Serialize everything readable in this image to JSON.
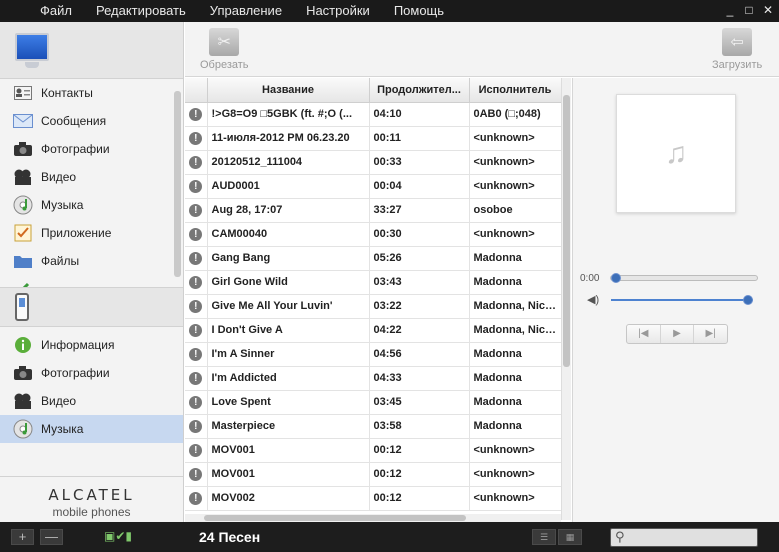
{
  "menu": {
    "items": [
      "Файл",
      "Редактировать",
      "Управление",
      "Настройки",
      "Помощь"
    ],
    "window_controls": [
      "_",
      "□",
      "✕"
    ]
  },
  "sidebar": {
    "computer_items": [
      {
        "label": "Контакты",
        "icon": "contacts-icon"
      },
      {
        "label": "Сообщения",
        "icon": "messages-icon"
      },
      {
        "label": "Фотографии",
        "icon": "camera-icon"
      },
      {
        "label": "Видео",
        "icon": "film-icon"
      },
      {
        "label": "Музыка",
        "icon": "music-cd-icon"
      },
      {
        "label": "Приложение",
        "icon": "app-icon"
      },
      {
        "label": "Файлы",
        "icon": "folder-icon"
      }
    ],
    "device_items": [
      {
        "label": "Информация",
        "icon": "info-icon"
      },
      {
        "label": "Фотографии",
        "icon": "camera-icon"
      },
      {
        "label": "Видео",
        "icon": "film-icon"
      },
      {
        "label": "Музыка",
        "icon": "music-cd-icon",
        "selected": true
      }
    ],
    "brand_line1": "ALCATEL",
    "brand_line2": "mobile phones"
  },
  "toolbar": {
    "trim_label": "Обрезать",
    "upload_label": "Загрузить"
  },
  "table": {
    "columns": [
      "Название",
      "Продолжител...",
      "Исполнитель"
    ],
    "rows": [
      {
        "title": "!>G8=O9 □5GBK (ft. #;O (...",
        "duration": "04:10",
        "artist": "0AB0 (□;048)"
      },
      {
        "title": "11-июля-2012 PM 06.23.20",
        "duration": "00:11",
        "artist": "<unknown>"
      },
      {
        "title": "20120512_111004",
        "duration": "00:33",
        "artist": "<unknown>"
      },
      {
        "title": "AUD0001",
        "duration": "00:04",
        "artist": "<unknown>"
      },
      {
        "title": "Aug 28, 17:07",
        "duration": "33:27",
        "artist": "osoboe"
      },
      {
        "title": "CAM00040",
        "duration": "00:30",
        "artist": "<unknown>"
      },
      {
        "title": "Gang Bang",
        "duration": "05:26",
        "artist": "Madonna"
      },
      {
        "title": "Girl Gone Wild",
        "duration": "03:43",
        "artist": "Madonna"
      },
      {
        "title": "Give Me All Your Luvin'",
        "duration": "03:22",
        "artist": "Madonna, Nicki..."
      },
      {
        "title": "I Don't Give A",
        "duration": "04:22",
        "artist": "Madonna, Nicki..."
      },
      {
        "title": "I'm A Sinner",
        "duration": "04:56",
        "artist": "Madonna"
      },
      {
        "title": "I'm Addicted",
        "duration": "04:33",
        "artist": "Madonna"
      },
      {
        "title": "Love Spent",
        "duration": "03:45",
        "artist": "Madonna"
      },
      {
        "title": "Masterpiece",
        "duration": "03:58",
        "artist": "Madonna"
      },
      {
        "title": "MOV001",
        "duration": "00:12",
        "artist": "<unknown>"
      },
      {
        "title": "MOV001",
        "duration": "00:12",
        "artist": "<unknown>"
      },
      {
        "title": "MOV002",
        "duration": "00:12",
        "artist": "<unknown>"
      }
    ]
  },
  "player": {
    "time": "0:00",
    "progress": 0,
    "volume": 1.0
  },
  "statusbar": {
    "song_count": "24 Песен",
    "add_label": "+",
    "remove_label": "—"
  },
  "colors": {
    "accent": "#3d6fb8",
    "selection": "#c7d8f0",
    "menubar": "#1a1a1a"
  }
}
